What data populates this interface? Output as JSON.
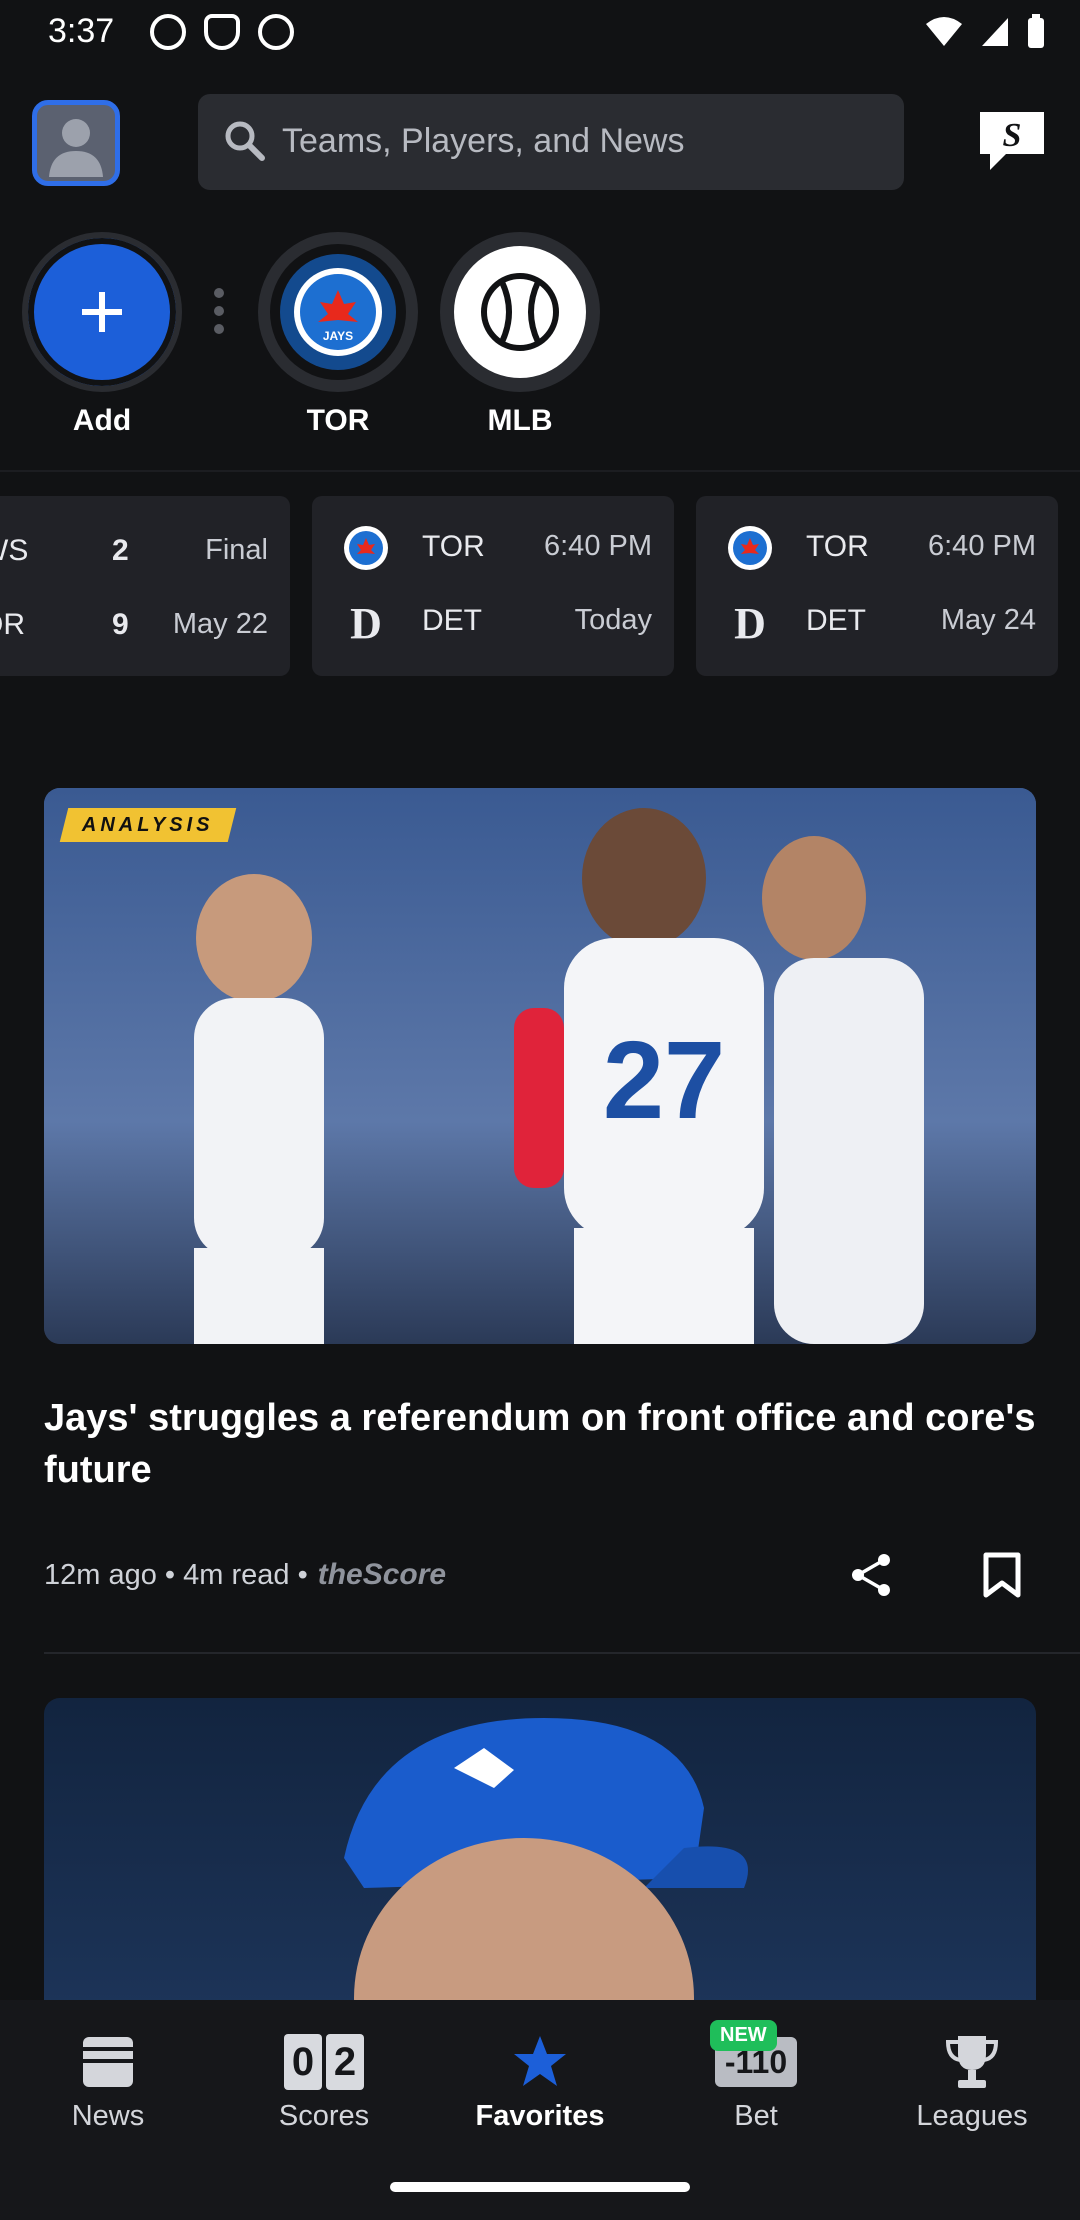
{
  "status_bar": {
    "time": "3:37"
  },
  "header": {
    "search_placeholder": "Teams, Players, and News"
  },
  "favorites": [
    {
      "label": "Add"
    },
    {
      "label": "TOR"
    },
    {
      "label": "MLB"
    }
  ],
  "games": [
    {
      "away": "WS",
      "away_score": "2",
      "home": "OR",
      "home_score": "9",
      "status": "Final",
      "date": "May 22"
    },
    {
      "away": "TOR",
      "home": "DET",
      "time": "6:40 PM",
      "date": "Today"
    },
    {
      "away": "TOR",
      "home": "DET",
      "time": "6:40 PM",
      "date": "May 24"
    }
  ],
  "article": {
    "badge": "ANALYSIS",
    "headline": "Jays' struggles a referendum on front office and core's future",
    "meta": "12m ago • 4m read •",
    "brand": "theScore"
  },
  "bottom_nav": {
    "items": [
      {
        "label": "News"
      },
      {
        "label": "Scores",
        "digit_a": "0",
        "digit_b": "2"
      },
      {
        "label": "Favorites"
      },
      {
        "label": "Bet",
        "tile": "-110",
        "badge": "NEW"
      },
      {
        "label": "Leagues"
      }
    ]
  },
  "colors": {
    "accent": "#2f6ee8",
    "brand_blue": "#1c5fd9",
    "badge_yellow": "#f1c232",
    "new_green": "#1fbe5a"
  }
}
